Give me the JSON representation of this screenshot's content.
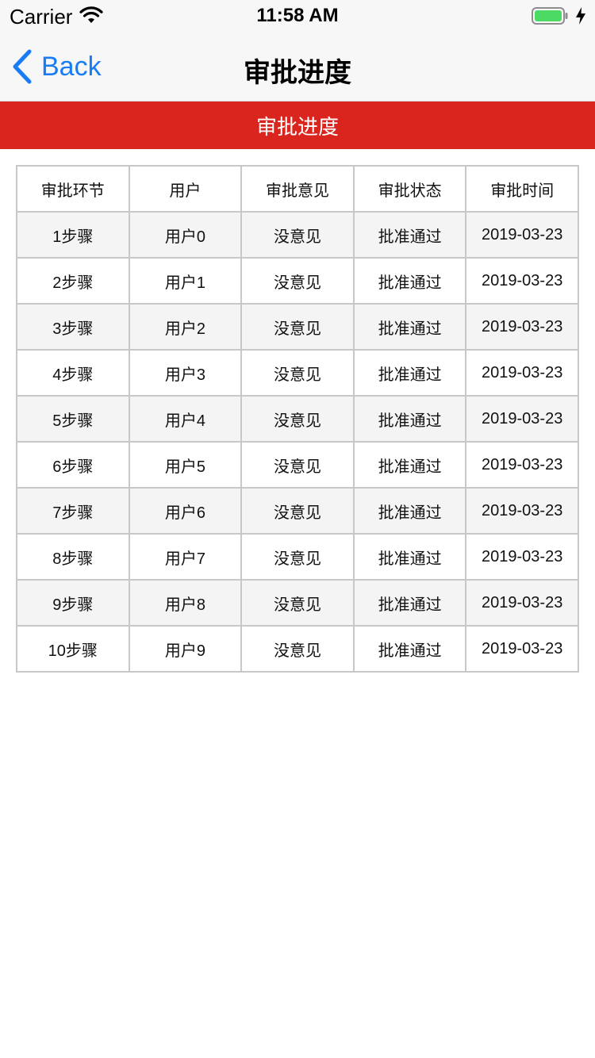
{
  "status_bar": {
    "carrier": "Carrier",
    "time": "11:58 AM"
  },
  "nav": {
    "back_label": "Back",
    "title": "审批进度"
  },
  "banner": {
    "title": "审批进度"
  },
  "colors": {
    "accent": "#1a7cf5",
    "banner": "#d9251d",
    "battery": "#4cd964"
  },
  "table": {
    "headers": [
      "审批环节",
      "用户",
      "审批意见",
      "审批状态",
      "审批时间"
    ],
    "rows": [
      [
        "1步骤",
        "用户0",
        "没意见",
        "批准通过",
        "2019-03-23"
      ],
      [
        "2步骤",
        "用户1",
        "没意见",
        "批准通过",
        "2019-03-23"
      ],
      [
        "3步骤",
        "用户2",
        "没意见",
        "批准通过",
        "2019-03-23"
      ],
      [
        "4步骤",
        "用户3",
        "没意见",
        "批准通过",
        "2019-03-23"
      ],
      [
        "5步骤",
        "用户4",
        "没意见",
        "批准通过",
        "2019-03-23"
      ],
      [
        "6步骤",
        "用户5",
        "没意见",
        "批准通过",
        "2019-03-23"
      ],
      [
        "7步骤",
        "用户6",
        "没意见",
        "批准通过",
        "2019-03-23"
      ],
      [
        "8步骤",
        "用户7",
        "没意见",
        "批准通过",
        "2019-03-23"
      ],
      [
        "9步骤",
        "用户8",
        "没意见",
        "批准通过",
        "2019-03-23"
      ],
      [
        "10步骤",
        "用户9",
        "没意见",
        "批准通过",
        "2019-03-23"
      ]
    ]
  }
}
